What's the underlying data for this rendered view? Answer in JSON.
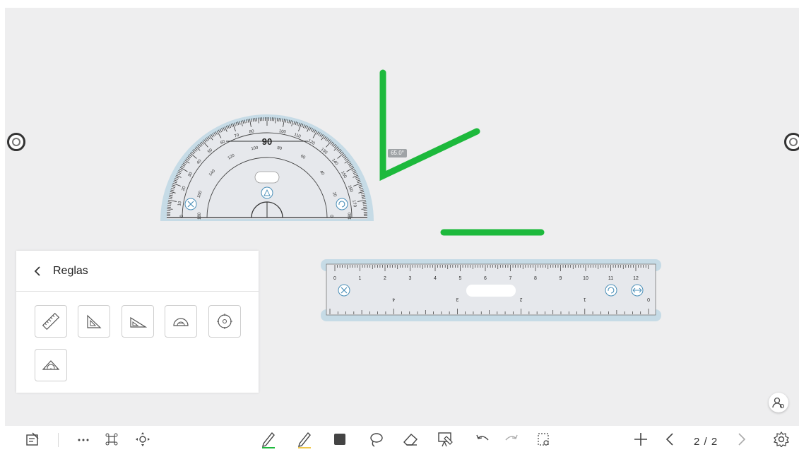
{
  "canvas": {
    "angle_readout": "65.0°"
  },
  "protractor": {
    "center_label": "90",
    "outer_scale": [
      "10",
      "20",
      "30",
      "40",
      "50",
      "60",
      "70",
      "80",
      "90",
      "100",
      "110",
      "120",
      "130",
      "140",
      "150",
      "160",
      "170"
    ],
    "inner_scale": [
      "0",
      "20",
      "40",
      "60",
      "80",
      "100",
      "120",
      "140",
      "160",
      "180"
    ],
    "end_labels": [
      "0",
      "180",
      "0",
      "180"
    ]
  },
  "ruler": {
    "top_numbers": [
      "0",
      "1",
      "2",
      "3",
      "4",
      "5",
      "6",
      "7",
      "8",
      "9",
      "10",
      "11",
      "12"
    ],
    "bottom_numbers": [
      "4",
      "3",
      "2",
      "1",
      "0"
    ]
  },
  "rulers_panel": {
    "title": "Reglas",
    "tools": [
      {
        "icon": "ruler-icon"
      },
      {
        "icon": "set-square-45-icon"
      },
      {
        "icon": "set-square-30-icon"
      },
      {
        "icon": "protractor-icon"
      },
      {
        "icon": "compass-icon"
      },
      {
        "icon": "triangle-ruler-icon"
      }
    ]
  },
  "toolbar": {
    "page_indicator": "2 / 2",
    "icons": [
      "notes-icon",
      "more-icon",
      "group-icon",
      "move-icon",
      "pen-icon",
      "highlighter-icon",
      "shape-icon",
      "lasso-icon",
      "eraser-icon",
      "clear-screen-icon",
      "undo-icon",
      "redo-icon",
      "screenshot-icon",
      "add-page-icon",
      "prev-page-icon",
      "next-page-icon",
      "settings-icon"
    ]
  },
  "colors": {
    "ink_green": "#1db93c",
    "tool_blue": "#c6dbe6",
    "tool_body": "#e6e8ec",
    "canvas_bg": "#eeeeef"
  }
}
